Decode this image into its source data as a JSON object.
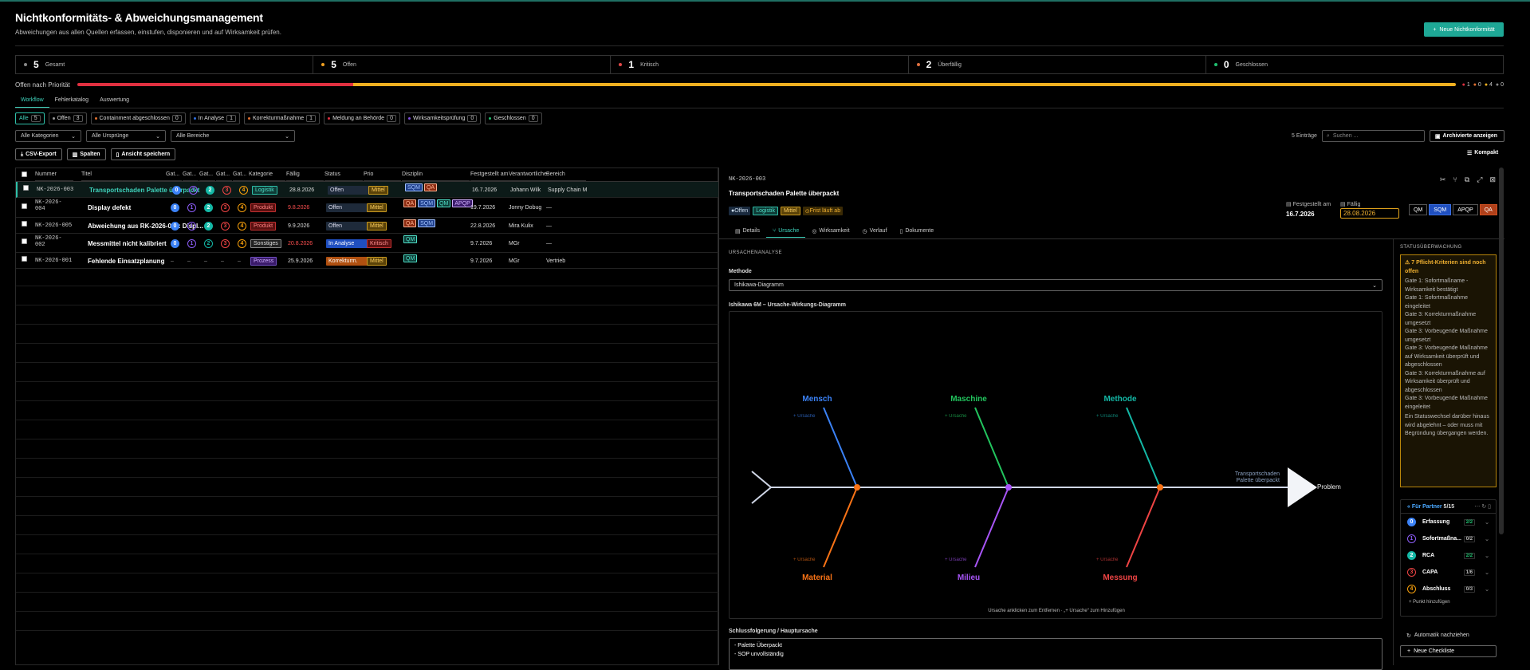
{
  "header": {
    "title": "Nichtkonformitäts- & Abweichungsmanagement",
    "subtitle": "Abweichungen aus allen Quellen erfassen, einstufen, disponieren und auf Wirksamkeit prüfen.",
    "new_button": "Neue Nichtkonformität"
  },
  "stats": [
    {
      "num": "5",
      "label": "Gesamt",
      "color": "#888888"
    },
    {
      "num": "5",
      "label": "Offen",
      "color": "#f0a020"
    },
    {
      "num": "1",
      "label": "Kritisch",
      "color": "#e04848"
    },
    {
      "num": "2",
      "label": "Überfällig",
      "color": "#e07040"
    },
    {
      "num": "0",
      "label": "Geschlossen",
      "color": "#20c070"
    }
  ],
  "priority": {
    "label": "Offen nach Priorität",
    "legend": [
      "1",
      "0",
      "4",
      "0"
    ],
    "shares": [
      1,
      0,
      4,
      0
    ],
    "colors": [
      "#e03040",
      "#e07030",
      "#f0b020",
      "#888888"
    ]
  },
  "tabs": [
    "Workflow",
    "Fehlerkatalog",
    "Auswertung"
  ],
  "filters": [
    {
      "label": "Alle",
      "count": "5",
      "color": ""
    },
    {
      "label": "Offen",
      "count": "3",
      "color": "#999999"
    },
    {
      "label": "Containment abgeschlossen",
      "count": "0",
      "color": "#e07030"
    },
    {
      "label": "In Analyse",
      "count": "1",
      "color": "#3070e0"
    },
    {
      "label": "Korrekturmaßnahme",
      "count": "1",
      "color": "#e07030"
    },
    {
      "label": "Meldung an Behörde",
      "count": "0",
      "color": "#e03040"
    },
    {
      "label": "Wirksamkeitsprüfung",
      "count": "0",
      "color": "#8050e0"
    },
    {
      "label": "Geschlossen",
      "count": "0",
      "color": "#20c070"
    }
  ],
  "selects": {
    "kategorien": "Alle Kategorien",
    "ursprunge": "Alle Ursprünge",
    "bereiche": "Alle Bereiche"
  },
  "toolbar": {
    "csv": "CSV-Export",
    "spalten": "Spalten",
    "ansicht": "Ansicht speichern",
    "entries": "5 Einträge",
    "search_placeholder": "Suchen ...",
    "archiv": "Archivierte anzeigen",
    "kompakt": "Kompakt"
  },
  "columns": [
    "Nummer",
    "Titel",
    "Gat...",
    "Gat...",
    "Gat...",
    "Gat...",
    "Gat...",
    "Kategorie",
    "Fällig",
    "Status",
    "Prio",
    "Disziplin",
    "Festgestellt am",
    "Verantwortliche",
    "Bereich"
  ],
  "rows": [
    {
      "nr": "NK-2026-003",
      "nr2": "",
      "title": "Transportschaden Palette überpackt",
      "gates": [
        "0",
        "1",
        "2",
        "3",
        "4"
      ],
      "kat": "Logistik",
      "due": "28.8.2026",
      "status": "Offen",
      "prio": "Mittel",
      "disz": [
        "SQM",
        "QA"
      ],
      "fest": "16.7.2026",
      "verant": "Johann Wilk",
      "bereich": "Supply Chain M..."
    },
    {
      "nr": "NK-2026-",
      "nr2": "004",
      "title": "Display defekt",
      "gates": [
        "0",
        "1",
        "2",
        "3",
        "4"
      ],
      "kat": "Produkt",
      "due": "9.8.2026",
      "status": "Offen",
      "prio": "Mittel",
      "disz": [
        "QA",
        "SQM",
        "QM",
        "APQP"
      ],
      "fest": "19.7.2026",
      "verant": "Jonny Dobug",
      "bereich": "—"
    },
    {
      "nr": "NK-2026-005",
      "nr2": "",
      "title": "Abweichung aus RK-2026-001: Displ...",
      "gates": [
        "0",
        "1",
        "2",
        "3",
        "4"
      ],
      "kat": "Produkt",
      "due": "9.9.2026",
      "status": "Offen",
      "prio": "Mittel",
      "disz": [
        "QA",
        "SQM"
      ],
      "fest": "22.8.2026",
      "verant": "Mira Kulix",
      "bereich": "—"
    },
    {
      "nr": "NK-2026-",
      "nr2": "002",
      "title": "Messmittel nicht kalibriert",
      "gates": [
        "0",
        "1",
        "2",
        "3",
        "4"
      ],
      "kat": "Sonstiges",
      "due": "20.8.2026",
      "status": "In Analyse",
      "prio": "Kritisch",
      "disz": [
        "QM"
      ],
      "fest": "9.7.2026",
      "verant": "MGr",
      "bereich": "—"
    },
    {
      "nr": "NK-2026-001",
      "nr2": "",
      "title": "Fehlende Einsatzplanung",
      "gates": [
        "–",
        "–",
        "–",
        "–",
        "–"
      ],
      "kat": "Prozess",
      "due": "25.9.2026",
      "status": "Korrekturm.",
      "prio": "Mittel",
      "disz": [
        "QM"
      ],
      "fest": "9.7.2026",
      "verant": "MGr",
      "bereich": "Vertrieb"
    }
  ],
  "panel": {
    "nr": "NK-2026-003",
    "title": "Transportschaden Palette überpackt",
    "tags": [
      "Offen",
      "Logistik",
      "Mittel",
      "Frist läuft ab"
    ],
    "fest_label": "Festgestellt am",
    "fest_val": "16.7.2026",
    "due_label": "Fällig",
    "due_val": "28.08.2026",
    "disc": [
      "QM",
      "SQM",
      "APQP",
      "QA"
    ],
    "tabs": [
      "Details",
      "Ursache",
      "Wirksamkeit",
      "Verlauf",
      "Dokumente"
    ],
    "section": "URSACHENANALYSE",
    "methode_label": "Methode",
    "methode_val": "Ishikawa-Diagramm",
    "fish_title": "Ishikawa 6M – Ursache-Wirkungs-Diagramm",
    "fish": {
      "top": [
        "Mensch",
        "Maschine",
        "Methode"
      ],
      "bottom": [
        "Material",
        "Milieu",
        "Messung"
      ],
      "add": "+ Ursache",
      "effect": "Transportschaden Palette überpackt",
      "problem": "Problem",
      "hint": "Ursache anklicken zum Entfernen · „+ Ursache“ zum Hinzufügen",
      "colors": [
        "#3b82f6",
        "#22c55e",
        "#14b8a6",
        "#f97316",
        "#a855f7",
        "#ef4444"
      ]
    },
    "concl_label": "Schlussfolgerung / Hauptursache",
    "concl_lines": [
      "- Palette Überpackt",
      "- SOP unvollständig"
    ]
  },
  "side": {
    "title": "STATUSÜBERWACHUNG",
    "warn_title": "7 Pflicht-Kriterien sind noch offen",
    "warn_items": [
      "Gate 1: Sofortmaßname - Wirksamkeit bestätigt",
      "Gate 1: Sofortmaßnahme eingeleitet",
      "Gate 3: Korrekturmaßnahme umgesetzt",
      "Gate 3: Vorbeugende Maßnahme umgesetzt",
      "Gate 3: Vorbeugende Maßnahme auf Wirksamkeit überprüft und abgeschlossen",
      "Gate 3: Korrekturmaßnahme auf Wirksamkeit überprüft und abgeschlossen",
      "Gate 3: Vorbeugende Maßnahme eingeleitet"
    ],
    "warn_note": "Ein Statuswechsel darüber hinaus wird abgelehnt – oder muss mit Begründung übergangen werden.",
    "partner": "Für Partner",
    "partner_count": "5/15",
    "phases": [
      {
        "n": "0",
        "name": "Erfassung",
        "c": "2/2"
      },
      {
        "n": "1",
        "name": "Sofortmaßna...",
        "c": "0/2"
      },
      {
        "n": "2",
        "name": "RCA",
        "c": "2/2"
      },
      {
        "n": "3",
        "name": "CAPA",
        "c": "1/6"
      },
      {
        "n": "4",
        "name": "Abschluss",
        "c": "0/3"
      }
    ],
    "add_point": "+ Punkt hinzufügen",
    "auto": "Automatik nachziehen",
    "new_list": "Neue Checkliste"
  }
}
